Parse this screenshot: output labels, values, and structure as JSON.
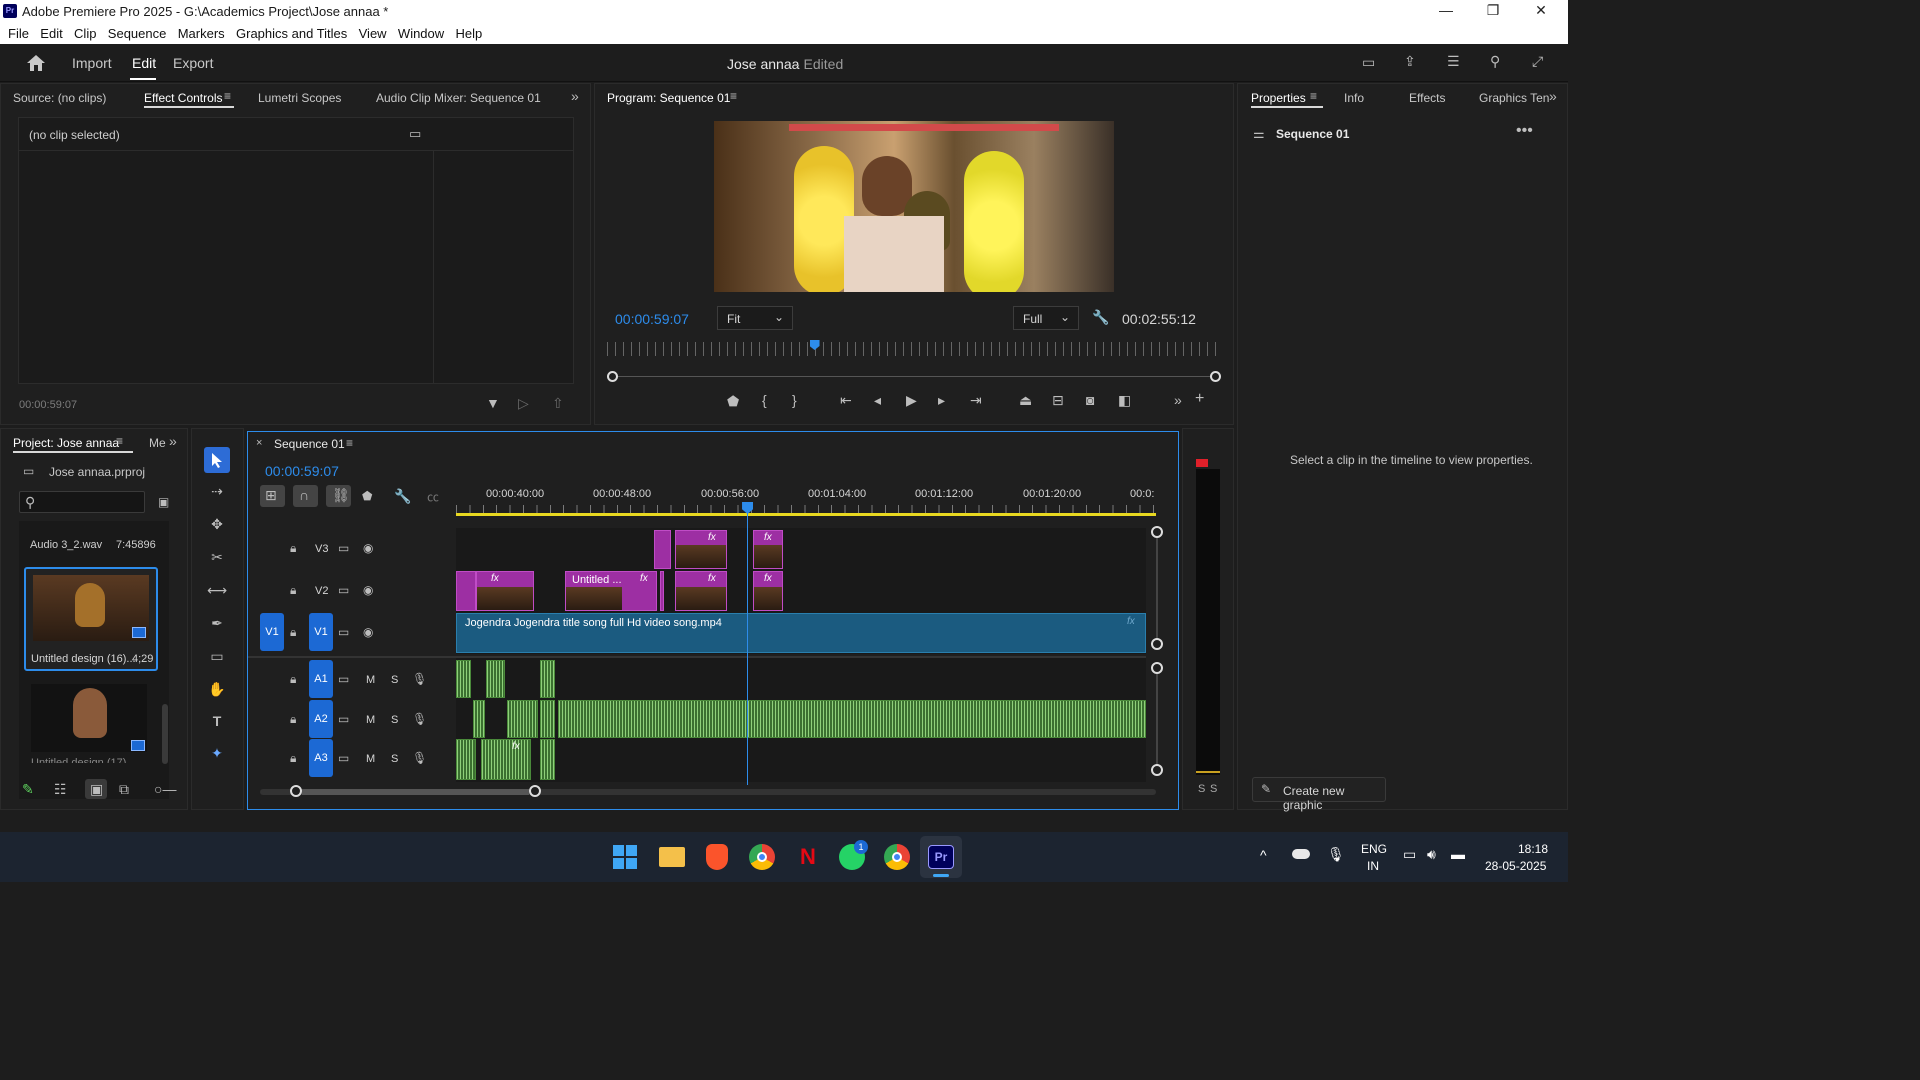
{
  "app": {
    "title": "Adobe Premiere Pro 2025 - G:\\Academics Project\\Jose annaa *",
    "icon_text": "Pr",
    "window_controls": [
      "—",
      "❐",
      "✕"
    ]
  },
  "menu": [
    "File",
    "Edit",
    "Clip",
    "Sequence",
    "Markers",
    "Graphics and Titles",
    "View",
    "Window",
    "Help"
  ],
  "header": {
    "nav": [
      "Import",
      "Edit",
      "Export"
    ],
    "active": "Edit",
    "project_name": "Jose annaa",
    "project_state": "- Edited"
  },
  "source_panel": {
    "tabs": [
      "Source: (no clips)",
      "Effect Controls",
      "Lumetri Scopes",
      "Audio Clip Mixer: Sequence 01"
    ],
    "active_tab": "Effect Controls",
    "no_clip": "(no clip selected)",
    "timecode": "00:00:59:07"
  },
  "program_monitor": {
    "title": "Program: Sequence 01",
    "timecode": "00:00:59:07",
    "fit": "Fit",
    "quality": "Full",
    "duration": "00:02:55:12",
    "playhead": 0.338
  },
  "properties_panel": {
    "tabs": [
      "Properties",
      "Info",
      "Effects",
      "Graphics Ten"
    ],
    "active_tab": "Properties",
    "sequence": "Sequence 01",
    "message": "Select a clip in the timeline to view properties.",
    "create_graphic": "Create new graphic"
  },
  "project_panel": {
    "tab": "Project: Jose annaa",
    "tab2": "Me",
    "file": "Jose annaa.prproj",
    "items": [
      {
        "name": "Audio 3_2.wav",
        "duration": "7:45896"
      },
      {
        "name": "Untitled design (16)...",
        "duration": "4;29"
      },
      {
        "name": "Untitled design (17)",
        "duration": ""
      }
    ]
  },
  "timeline": {
    "tab": "Sequence 01",
    "timecode": "00:00:59:07",
    "ruler": [
      "00:00:40:00",
      "00:00:48:00",
      "00:00:56:00",
      "00:01:04:00",
      "00:01:12:00",
      "00:01:20:00",
      "00:0:"
    ],
    "video_tracks": [
      "V3",
      "V2",
      "V1"
    ],
    "audio_tracks": [
      "A1",
      "A2",
      "A3"
    ],
    "source_patch": "V1",
    "main_clip": "Jogendra Jogendra title  song full  Hd video song.mp4",
    "untitled_clip": "Untitled ...",
    "fx": "fx",
    "mute": "M",
    "solo": "S",
    "meter_labels": [
      "S",
      "S"
    ]
  },
  "taskbar": {
    "lang": "ENG",
    "region": "IN",
    "time": "18:18",
    "date": "28-05-2025",
    "whatsapp_badge": "1"
  },
  "colors": {
    "accent": "#2d8ceb",
    "purple_clip": "#9d2fa3",
    "blue_clip": "#1b5b80",
    "audio_green": "#8fd07a"
  }
}
